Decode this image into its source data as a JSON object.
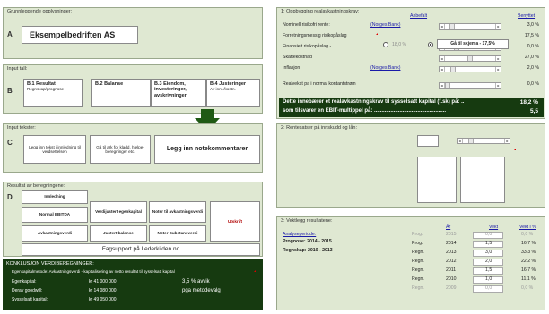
{
  "left": {
    "sectionA": {
      "title": "Grunnleggende opplysninger:",
      "letter": "A",
      "company": "Eksempelbedriften AS"
    },
    "sectionB": {
      "title": "Input tall:",
      "letter": "B",
      "buttons": [
        {
          "title": "B.1 Resultat",
          "sub": "Regnskap/prognose"
        },
        {
          "title": "B.2 Balanse",
          "sub": ""
        },
        {
          "title": "B.3 Eiendom, investeringer, avskrivninger",
          "sub": ""
        },
        {
          "title": "B.4 Justeringer",
          "sub": "Av innt./kostn."
        }
      ]
    },
    "sectionC": {
      "title": "Input tekster:",
      "letter": "C",
      "btn1": "Legg inn tekst i innledning til verdsettelsen",
      "btn2": "Gå til ark for kladd, hjelpe-beregninger etc.",
      "btn3": "Legg inn notekommentarer"
    },
    "sectionD": {
      "title": "Resultat av beregningene:",
      "letter": "D",
      "innledning": "Innledning",
      "normal_ebitda": "Normal EBITDA",
      "verdijustert": "Verdijustert egenkapital",
      "noter_til": "Noter til avkastningsverdi",
      "utskrift": "Utskrift",
      "avkastningsverdi": "Avkastningsverdi",
      "justert_balanse": "Justert balanse",
      "noter_substans": "Noter Substansverdi",
      "fagsupport": "Fagsupport  på  Lederkilden.no"
    },
    "konklusjon": {
      "title": "KONKLUSJON VERDIBEREGNINGER:",
      "line1": "Egenkapitalmetode:  Avkastningsverdi - kapitalisering av netto resultat til sysselsatt kapital",
      "rows": [
        {
          "label": "Egenkapital:",
          "value": "kr 41 000 000",
          "note": "3,5 % avvik"
        },
        {
          "label": "Derav goodwill:",
          "value": "kr 14 080 000",
          "note": "pga metodevalg"
        },
        {
          "label": "Sysselsatt kapital:",
          "value": "kr 49 050 000",
          "note": ""
        }
      ]
    }
  },
  "right": {
    "section1": {
      "title": "1: Oppbygging realavkastningskrav:",
      "anbefalt": "Anbefalt",
      "benyttet": "Benyttet",
      "rows": [
        {
          "label": "Nominell risikofri rente:",
          "link": "(Norges Bank)",
          "value": "3,0 %",
          "scroll": true,
          "thumb": 0.1
        },
        {
          "label": "Forretningsmessig risikopåslag",
          "link": "",
          "value": "17,5 %",
          "scroll": false,
          "thumb": 0
        },
        {
          "label": "Finansielt risikopåslag -",
          "link": "",
          "value": "0,0 %",
          "scroll": true,
          "thumb": 0.2
        },
        {
          "label": "Skattekostnad",
          "link": "",
          "value": "27,0 %",
          "scroll": true,
          "thumb": 0.5
        },
        {
          "label": "Inflasjon",
          "link": "(Norges Bank)",
          "value": "2,0 %",
          "scroll": true,
          "thumb": 0.12
        },
        {
          "label": "Realvekst pa i normal kontantstrøm",
          "link": "",
          "value": "0,0 %",
          "scroll": true,
          "thumb": 0.0
        }
      ],
      "radio_value": "18,0 %",
      "skjema_btn": "Gå til skjema - 17,5%",
      "summary1_label": "Dette innebærer et realavkastningskrav til sysselsatt kapital (f.sk) på: ..",
      "summary1_value": "18,2 %",
      "summary2_label": "som tilsvarer en EBIT-multippel på: ................................................",
      "summary2_value": "5,5"
    },
    "section2": {
      "title": "2: Rentesatser på innskudd og lån:"
    },
    "section3": {
      "title": "3: Vektlegg resultatene:",
      "headers": {
        "ar": "År",
        "vekt": "Vekt",
        "vektpct": "Vekt i %"
      },
      "analyse_label": "Analyseperiode:",
      "prognose_label": "Prognose: 2014 - 2015",
      "regnskap_label": "Regnskap: 2010 - 2013",
      "rows": [
        {
          "type": "Prog.",
          "year": "2015",
          "vekt": "0,0",
          "pct": "0,0 %",
          "grey": true
        },
        {
          "type": "Prog.",
          "year": "2014",
          "vekt": "1,5",
          "pct": "16,7 %",
          "grey": false
        },
        {
          "type": "Regn.",
          "year": "2013",
          "vekt": "3,0",
          "pct": "33,3 %",
          "grey": false
        },
        {
          "type": "Regn.",
          "year": "2012",
          "vekt": "2,0",
          "pct": "22,2 %",
          "grey": false
        },
        {
          "type": "Regn.",
          "year": "2011",
          "vekt": "1,5",
          "pct": "16,7 %",
          "grey": false
        },
        {
          "type": "Regn.",
          "year": "2010",
          "vekt": "1,0",
          "pct": "11,1 %",
          "grey": false
        },
        {
          "type": "Regn.",
          "year": "2009",
          "vekt": "0,0",
          "pct": "0,0 %",
          "grey": true
        }
      ]
    }
  },
  "colors": {
    "panel": "#dfe8d2",
    "dark_green": "#163a10",
    "arrow": "#1f5a14",
    "link": "#1a1aa8"
  }
}
